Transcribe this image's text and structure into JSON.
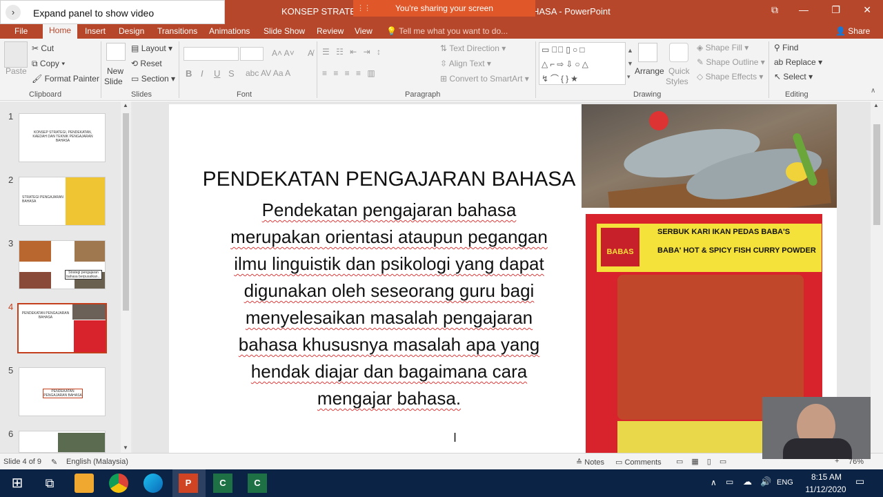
{
  "window": {
    "title_left": "KONSEP STRATEGI",
    "title_right": "HASA - PowerPoint",
    "restore_glyph": "⧉",
    "min_glyph": "—",
    "max_glyph": "❐",
    "close_glyph": "✕"
  },
  "overlay": {
    "expand_label": "Expand panel to show video",
    "expand_glyph": "›",
    "sharing": "You're sharing your screen"
  },
  "menu": {
    "file": "File",
    "home": "Home",
    "insert": "Insert",
    "design": "Design",
    "transitions": "Transitions",
    "animations": "Animations",
    "slideshow": "Slide Show",
    "review": "Review",
    "view": "View",
    "tell": "Tell me what you want to do...",
    "share": "Share"
  },
  "ribbon": {
    "clipboard": {
      "paste": "Paste",
      "cut": "Cut",
      "copy": "Copy",
      "format_painter": "Format Painter",
      "label": "Clipboard"
    },
    "slides": {
      "new_slide": "New",
      "new_slide2": "Slide",
      "layout": "Layout",
      "reset": "Reset",
      "section": "Section",
      "label": "Slides"
    },
    "font": {
      "label": "Font",
      "bold": "B",
      "italic": "I",
      "underline": "U",
      "strike": "S"
    },
    "paragraph": {
      "text_direction": "Text Direction",
      "align_text": "Align Text",
      "convert": "Convert to SmartArt",
      "label": "Paragraph"
    },
    "drawing": {
      "arrange": "Arrange",
      "quick_styles": "Quick",
      "quick_styles2": "Styles",
      "shape_fill": "Shape Fill",
      "shape_outline": "Shape Outline",
      "shape_effects": "Shape Effects",
      "label": "Drawing"
    },
    "editing": {
      "find": "Find",
      "replace": "Replace",
      "select": "Select",
      "label": "Editing"
    }
  },
  "thumbnails": [
    {
      "num": "1",
      "text": "KONSEP STRATEGI, PENDEKATAN, KAEDAH DAN TEKNIK PENGAJARAN BAHASA"
    },
    {
      "num": "2",
      "text": "STRATEGI PENGAJARAN BAHASA"
    },
    {
      "num": "3",
      "text": "Strategi pengajaran bahasa berpusatkan..."
    },
    {
      "num": "4",
      "text": "PENDEKATAN PENGAJARAN BAHASA"
    },
    {
      "num": "5",
      "text": "PENDEKATAN PENGAJARAN BAHASA"
    },
    {
      "num": "6",
      "text": ""
    }
  ],
  "slide": {
    "title": "PENDEKATAN PENGAJARAN BAHASA",
    "body_lines": [
      "Pendekatan pengajaran bahasa",
      "merupakan orientasi ataupun pegangan",
      "ilmu linguistik dan psikologi yang dapat",
      "digunakan oleh seseorang guru bagi",
      "menyelesaikan masalah pengajaran",
      "bahasa khususnya masalah apa yang",
      "hendak diajar dan bagaimana cara",
      "mengajar bahasa."
    ],
    "package": {
      "brand": "BABAS",
      "line1": "SERBUK KARI IKAN PEDAS BABA'S",
      "line2": "BABA' HOT & SPICY FISH CURRY POWDER"
    }
  },
  "status": {
    "slide_of": "Slide 4 of 9",
    "language": "English (Malaysia)",
    "notes": "Notes",
    "comments": "Comments",
    "zoom": "76%"
  },
  "taskbar": {
    "lang": "ENG",
    "time": "8:15 AM",
    "date": "11/12/2020"
  },
  "colors": {
    "accent": "#b7472a",
    "share_bar": "#e0582a",
    "taskbar": "#0b2345"
  }
}
